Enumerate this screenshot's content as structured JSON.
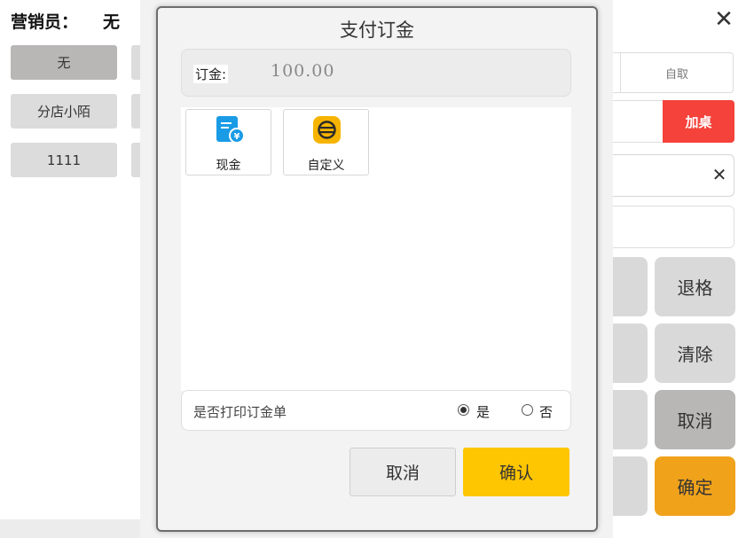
{
  "background": {
    "salesman_label": "营销员：",
    "salesman_value": "无",
    "staff": [
      {
        "label": "无",
        "selected": true
      },
      {
        "label": "分店小陌",
        "selected": false
      },
      {
        "label": "1111",
        "selected": false
      }
    ],
    "tab_self_pickup": "自取",
    "add_table_label": "加桌",
    "keys": [
      {
        "label": "退格",
        "style": "normal"
      },
      {
        "label": "清除",
        "style": "normal"
      },
      {
        "label": "取消",
        "style": "dark"
      },
      {
        "label": "确定",
        "style": "orange"
      }
    ]
  },
  "modal": {
    "title": "支付订金",
    "deposit_label": "订金:",
    "deposit_value": "100.00",
    "pay_methods": [
      {
        "label": "现金",
        "icon": "cash-icon",
        "color": "#1a9be6"
      },
      {
        "label": "自定义",
        "icon": "custom-payment-icon",
        "color": "#f6b400"
      }
    ],
    "print_label": "是否打印订金单",
    "print_yes": "是",
    "print_no": "否",
    "print_selected": "yes",
    "cancel_label": "取消",
    "confirm_label": "确认"
  },
  "colors": {
    "accent_red": "#f5423a",
    "confirm_yellow": "#fec501",
    "key_orange": "#f0a21b"
  }
}
